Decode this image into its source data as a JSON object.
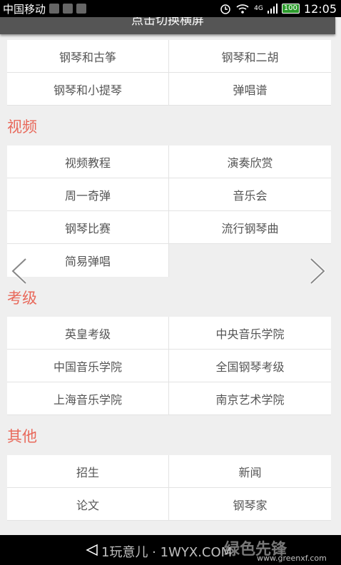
{
  "status_bar": {
    "carrier": "中国移动",
    "signal_type": "4G",
    "battery": "100",
    "time": "12:05"
  },
  "top_bar": {
    "label": "点击切换横屏"
  },
  "section_top": {
    "items": [
      "钢琴和古筝",
      "钢琴和二胡",
      "钢琴和小提琴",
      "弹唱谱"
    ]
  },
  "section_video": {
    "title": "视频",
    "items": [
      "视频教程",
      "演奏欣赏",
      "周一奇弹",
      "音乐会",
      "钢琴比赛",
      "流行钢琴曲",
      "简易弹唱"
    ]
  },
  "section_exam": {
    "title": "考级",
    "items": [
      "英皇考级",
      "中央音乐学院",
      "中国音乐学院",
      "全国钢琴考级",
      "上海音乐学院",
      "南京艺术学院"
    ]
  },
  "section_other": {
    "title": "其他",
    "items": [
      "招生",
      "新闻",
      "论文",
      "钢琴家"
    ]
  },
  "watermark": {
    "left": "1玩意儿 · 1WYX.COM",
    "right": "www.greenxf.com",
    "logo": "绿色先锋"
  },
  "colors": {
    "accent": "#e8685a",
    "status_bar": "#000000",
    "top_bar": "#555555"
  }
}
